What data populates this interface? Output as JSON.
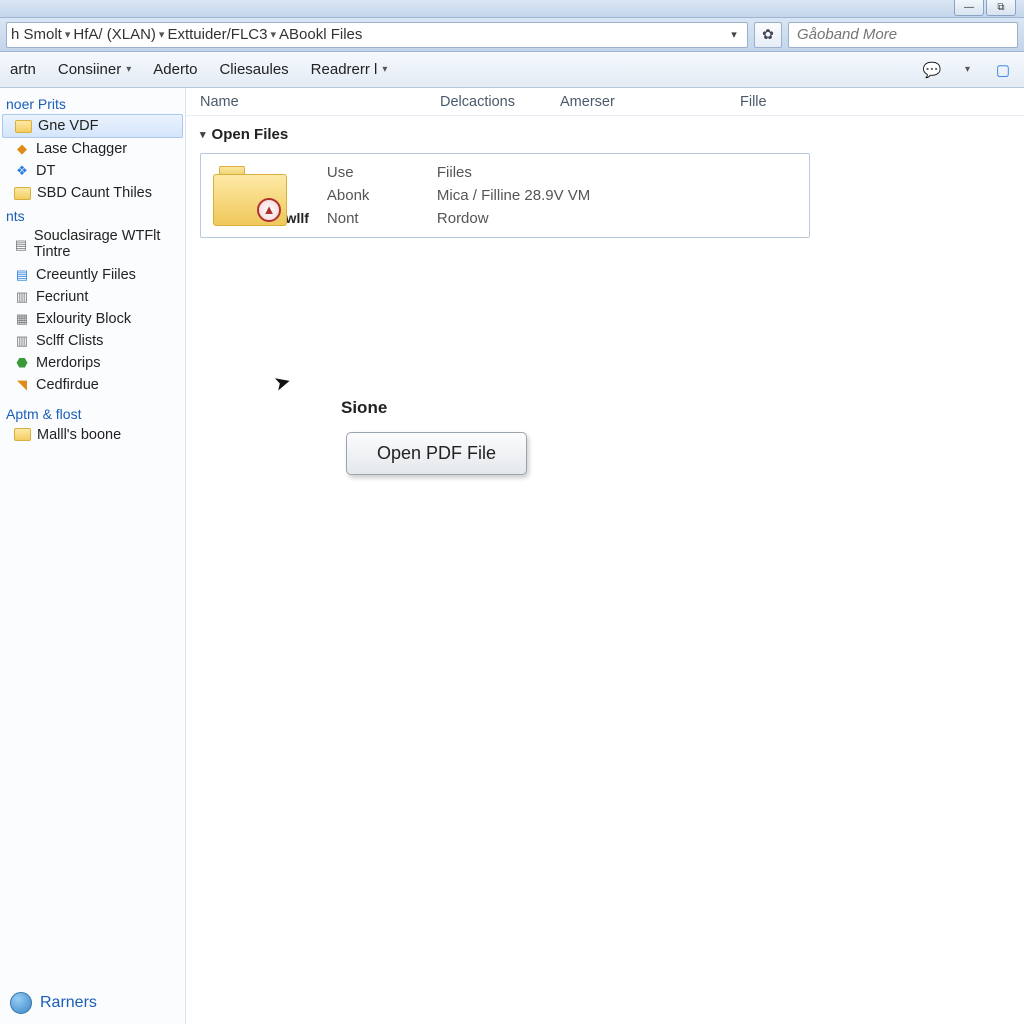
{
  "titlebar": {
    "min": "—",
    "max": "⧉"
  },
  "address": {
    "crumbs": [
      "h Smolt",
      "HfA/ (XLAN)",
      "Exttuider/FLC3",
      "ABookl Files"
    ]
  },
  "search": {
    "placeholder": "Gåoband More"
  },
  "toolbar": {
    "items": [
      "artn",
      "Consiiner",
      "Aderto",
      "Cliesaules",
      "Readrerr l"
    ]
  },
  "sidebar": {
    "groups": [
      {
        "header": "noer Prits",
        "items": [
          {
            "label": "Gne VDF",
            "icon": "folder",
            "selected": true
          },
          {
            "label": "Lase Chagger",
            "icon": "orange"
          },
          {
            "label": "DT",
            "icon": "blue"
          },
          {
            "label": "SBD Caunt Thiles",
            "icon": "folder"
          }
        ]
      },
      {
        "header": "nts",
        "items": [
          {
            "label": "Souclasirage WTFlt Tintre",
            "icon": "gray"
          },
          {
            "label": "Creeuntly Fiiles",
            "icon": "blue"
          },
          {
            "label": "Fecriunt",
            "icon": "gray"
          },
          {
            "label": "Exlourity Block",
            "icon": "gray"
          },
          {
            "label": "Sclff Clists",
            "icon": "gray"
          },
          {
            "label": "Merdorips",
            "icon": "green"
          },
          {
            "label": "Cedfirdue",
            "icon": "orange"
          }
        ]
      },
      {
        "header": "Aptm & flost",
        "items": [
          {
            "label": "Malll's boone",
            "icon": "folder"
          }
        ]
      }
    ]
  },
  "columns": {
    "name": "Name",
    "del": "Delcactions",
    "amer": "Amerser",
    "file": "Fille"
  },
  "group": {
    "title": "Open Files"
  },
  "file": {
    "name": "Fwllf",
    "meta": {
      "k1": "Use",
      "v1": "Fiiles",
      "k2": "Abonk",
      "v2": "Mica / Filline 28.9V VM",
      "k3": "Nont",
      "v3": "Rordow"
    }
  },
  "tooltip": {
    "label": "Sione",
    "button": "Open PDF File"
  },
  "bottom": {
    "label": "Rarners"
  }
}
